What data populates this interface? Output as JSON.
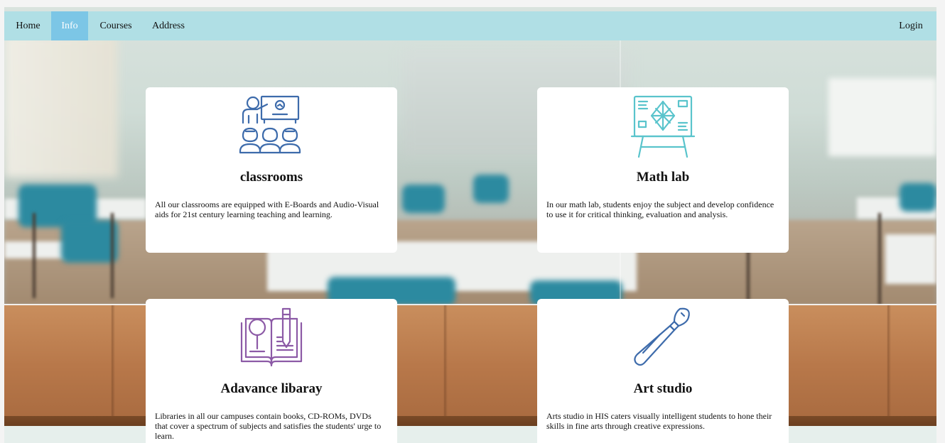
{
  "nav": {
    "items": [
      {
        "label": "Home"
      },
      {
        "label": "Info"
      },
      {
        "label": "Courses"
      },
      {
        "label": "Address"
      }
    ],
    "login": "Login",
    "active_color": "#7cc6e6",
    "bar_color": "#b0dfe5"
  },
  "cards": [
    {
      "title": "classrooms",
      "text": "All our classrooms are equipped with E-Boards and Audio-Visual aids for 21st century learning teaching and learning.",
      "icon": "classroom-icon",
      "icon_color": "#3d6bab"
    },
    {
      "title": "Math lab",
      "text": "In our math lab, students enjoy the subject and develop confidence to use it for critical thinking, evaluation and analysis.",
      "icon": "math-board-icon",
      "icon_color": "#5ac4cc"
    },
    {
      "title": "Adavance libaray",
      "text": "Libraries in all our campuses contain books, CD-ROMs, DVDs that cover a spectrum of subjects and satisfies the students' urge to learn.",
      "icon": "library-book-icon",
      "icon_color": "#8c5aa6"
    },
    {
      "title": "Art studio",
      "text": "Arts studio in HIS caters visually intelligent students to hone their skills in fine arts through creative expressions.",
      "icon": "paintbrush-icon",
      "icon_color": "#3d6bab"
    }
  ]
}
